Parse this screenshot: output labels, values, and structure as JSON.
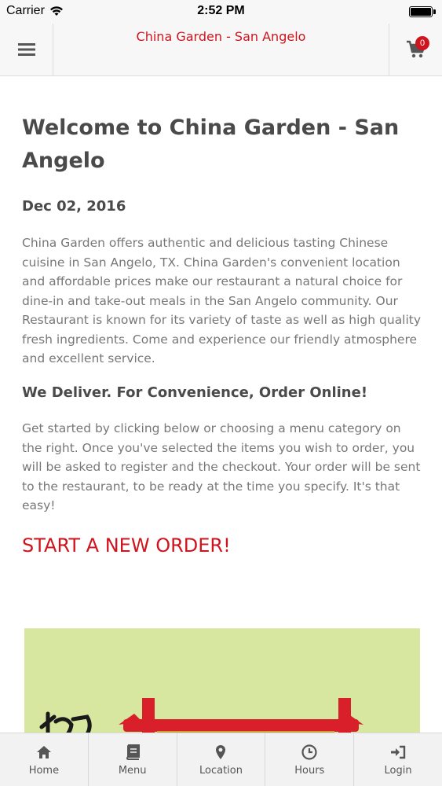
{
  "status_bar": {
    "carrier": "Carrier",
    "time": "2:52 PM"
  },
  "header": {
    "title": "China Garden - San Angelo",
    "cart_count": "0"
  },
  "main": {
    "title": "Welcome to China Garden - San Angelo",
    "date": "Dec 02, 2016",
    "intro": "China Garden offers authentic and delicious tasting Chinese cuisine in San Angelo, TX.  China Garden's convenient location and affordable prices make our restaurant a natural choice for dine-in and take-out meals in the San Angelo community. Our Restaurant is known for its variety of taste as well as high quality fresh ingredients. Come and experience our friendly atmosphere and excellent service.",
    "deliver_heading": "We Deliver. For Convenience, Order Online!",
    "instructions": "Get started by clicking below or choosing a menu category on the right. Once you've selected the items you wish to order, you will be asked to register and the checkout. Your order will be sent to the restaurant, to be ready at the time you specify. It's that easy!",
    "start_order": "START A NEW ORDER!"
  },
  "tabs": [
    {
      "label": "Home",
      "icon": "home-icon"
    },
    {
      "label": "Menu",
      "icon": "book-icon"
    },
    {
      "label": "Location",
      "icon": "map-pin-icon"
    },
    {
      "label": "Hours",
      "icon": "clock-icon"
    },
    {
      "label": "Login",
      "icon": "login-icon"
    }
  ],
  "colors": {
    "accent": "#d0141e",
    "header_bg": "#f7f7f7",
    "body_text": "#777777",
    "heading_text": "#4a4a4a"
  }
}
